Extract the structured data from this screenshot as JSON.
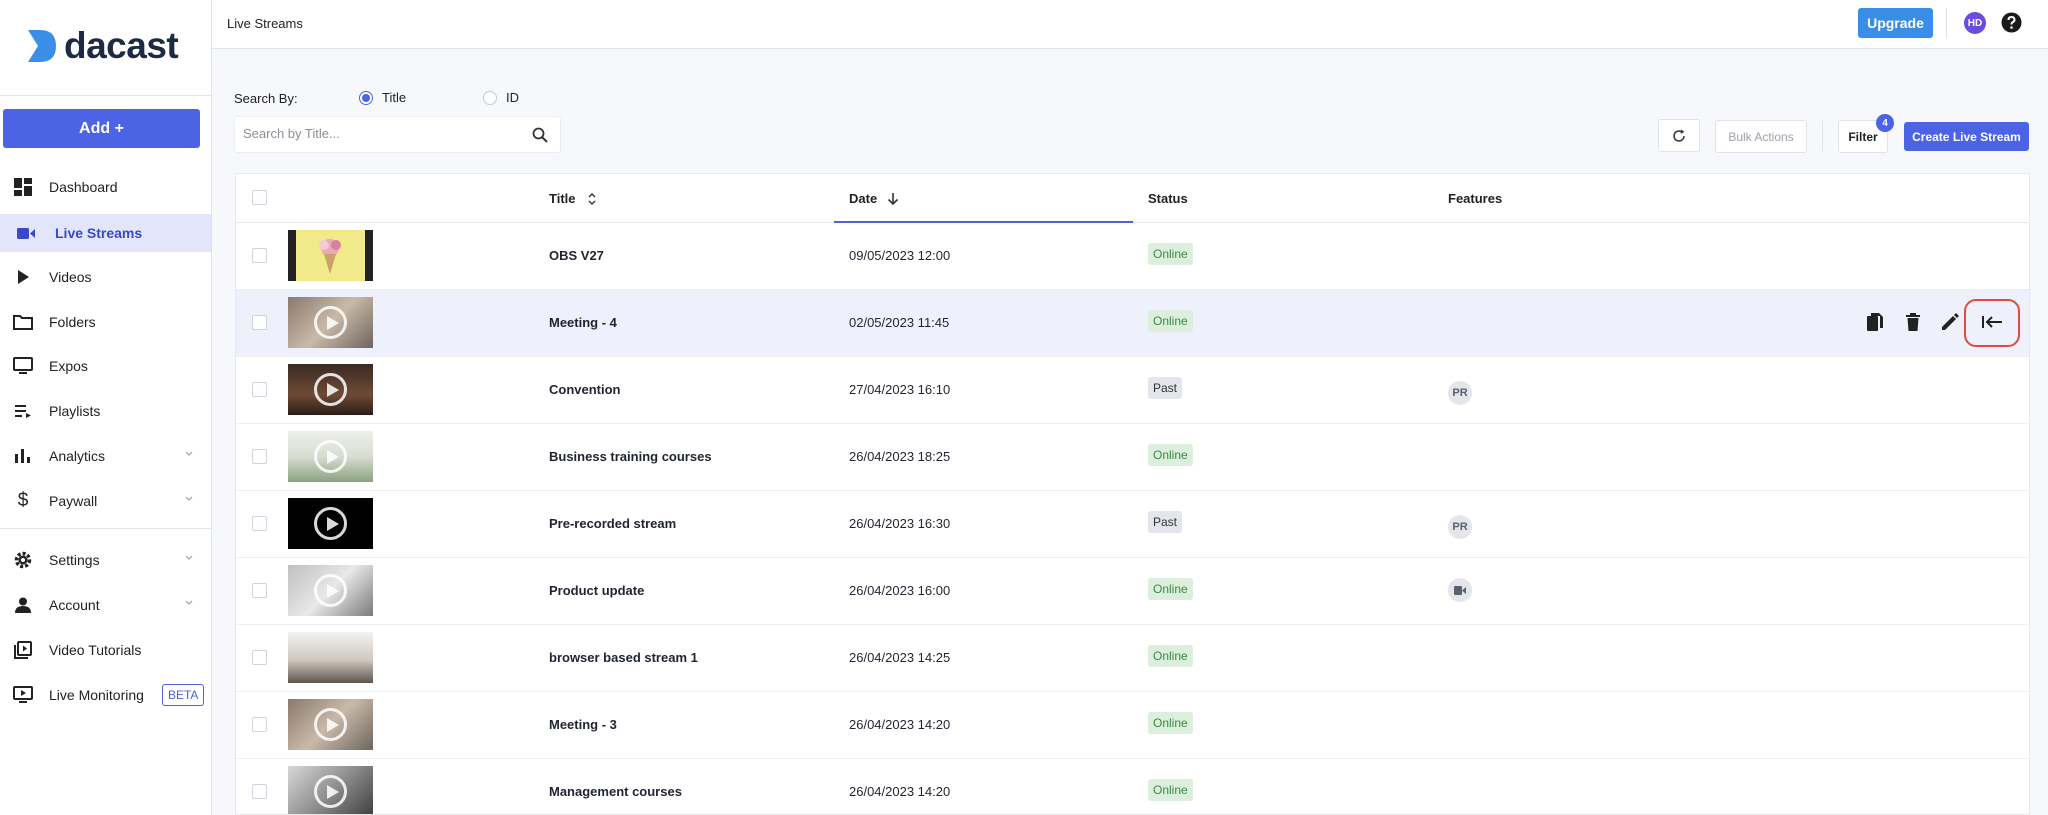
{
  "brand": {
    "name": "dacast"
  },
  "sidebar": {
    "add_label": "Add +",
    "items": [
      {
        "label": "Dashboard",
        "icon": "dashboard-icon"
      },
      {
        "label": "Live Streams",
        "icon": "video-camera-icon",
        "active": true
      },
      {
        "label": "Videos",
        "icon": "play-icon"
      },
      {
        "label": "Folders",
        "icon": "folder-icon"
      },
      {
        "label": "Expos",
        "icon": "monitor-icon"
      },
      {
        "label": "Playlists",
        "icon": "playlist-icon"
      },
      {
        "label": "Analytics",
        "icon": "bar-chart-icon",
        "expandable": true
      },
      {
        "label": "Paywall",
        "icon": "dollar-icon",
        "expandable": true
      },
      {
        "label": "Settings",
        "icon": "gear-icon",
        "expandable": true
      },
      {
        "label": "Account",
        "icon": "person-icon",
        "expandable": true
      },
      {
        "label": "Video Tutorials",
        "icon": "video-library-icon"
      },
      {
        "label": "Live Monitoring",
        "icon": "live-monitor-icon",
        "badge": "BETA"
      }
    ]
  },
  "header": {
    "breadcrumb": "Live Streams",
    "upgrade_label": "Upgrade",
    "avatar_initials": "HD"
  },
  "search": {
    "by_label": "Search By:",
    "options": [
      "Title",
      "ID"
    ],
    "selected": "Title",
    "placeholder": "Search by Title..."
  },
  "toolbar": {
    "bulk_label": "Bulk Actions",
    "filter_label": "Filter",
    "filter_count": "4",
    "create_label": "Create Live Stream"
  },
  "table": {
    "columns": {
      "title": "Title",
      "date": "Date",
      "status": "Status",
      "features": "Features"
    },
    "rows": [
      {
        "title": "OBS V27",
        "date": "09/05/2023 12:00",
        "status": "Online",
        "thumb": "yellow"
      },
      {
        "title": "Meeting - 4",
        "date": "02/05/2023 11:45",
        "status": "Online",
        "thumb": "office"
      },
      {
        "title": "Convention",
        "date": "27/04/2023 16:10",
        "status": "Past",
        "feature": "PR",
        "thumb": "dark"
      },
      {
        "title": "Business training courses",
        "date": "26/04/2023 18:25",
        "status": "Online",
        "thumb": "bright"
      },
      {
        "title": "Pre-recorded stream",
        "date": "26/04/2023 16:30",
        "status": "Past",
        "feature": "PR",
        "thumb": "black"
      },
      {
        "title": "Product update",
        "date": "26/04/2023 16:00",
        "status": "Online",
        "feature_icon": "video-camera-icon",
        "thumb": "grey"
      },
      {
        "title": "browser based stream 1",
        "date": "26/04/2023 14:25",
        "status": "Online",
        "thumb": "desk"
      },
      {
        "title": "Meeting - 3",
        "date": "26/04/2023 14:20",
        "status": "Online",
        "thumb": "office"
      },
      {
        "title": "Management courses",
        "date": "26/04/2023 14:20",
        "status": "Online",
        "thumb": "mgmt"
      }
    ],
    "hover_row_actions": [
      "copy-icon",
      "trash-icon",
      "pencil-icon",
      "collapse-left-icon"
    ]
  },
  "colors": {
    "accent": "#4c63e6",
    "upgrade": "#3b8ee8",
    "online_bg": "#dcefdd",
    "online_text": "#3a8a42",
    "highlight_ring": "#e04a3f"
  }
}
